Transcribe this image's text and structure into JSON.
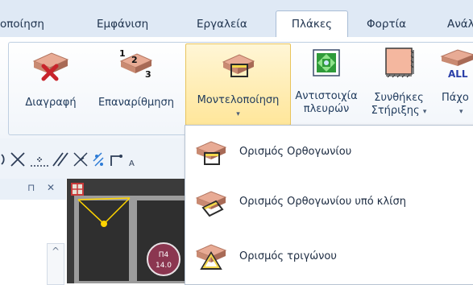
{
  "tabs": [
    {
      "label": "οποίηση",
      "active": false
    },
    {
      "label": "Εμφάνιση",
      "active": false
    },
    {
      "label": "Εργαλεία",
      "active": false
    },
    {
      "label": "Πλάκες",
      "active": true
    },
    {
      "label": "Φορτία",
      "active": false
    },
    {
      "label": "Ανάλ",
      "active": false
    }
  ],
  "ribbon": {
    "delete": {
      "label": "Διαγραφή",
      "icon": "slab-delete-icon"
    },
    "renumber": {
      "label": "Επαναρίθμηση",
      "icon": "slab-renumber-icon"
    },
    "modeling": {
      "label": "Μοντελοποίηση",
      "icon": "slab-modeling-icon",
      "chevron": "▾"
    },
    "correspond": {
      "label_line1": "Αντιστοιχία",
      "label_line2": "πλευρών",
      "icon": "edge-correspondence-icon"
    },
    "support": {
      "label_line1": "Συνθήκες",
      "label_line2": "Στήριξης",
      "chevron": "▾",
      "icon": "support-conditions-icon"
    },
    "thickness": {
      "label_line1": "Πάχο",
      "chevron": "▾",
      "icon_text": "ALL"
    }
  },
  "panel": {
    "pin_glyph": "⊓",
    "close_glyph": "✕",
    "scroll_up": "^"
  },
  "canvas": {
    "badge_line1": "Π4",
    "badge_line2": "14.0"
  },
  "menu": {
    "items": [
      {
        "label": "Ορισμός Ορθογωνίου",
        "icon": "rectangle-slab-icon"
      },
      {
        "label": "Ορισμός Ορθογωνίου υπό κλίση",
        "icon": "inclined-rectangle-slab-icon"
      },
      {
        "label": "Ορισμός τριγώνου",
        "icon": "triangle-slab-icon"
      }
    ]
  },
  "colors": {
    "tab_bg": "#dfe9f5",
    "hot_button": "#ffe69a",
    "slab_top": "#e3a58f",
    "delete_x": "#c8242b",
    "green_icon": "#2f9b3a",
    "canvas_bg": "#3b3b3b",
    "badge": "#8b3650"
  }
}
